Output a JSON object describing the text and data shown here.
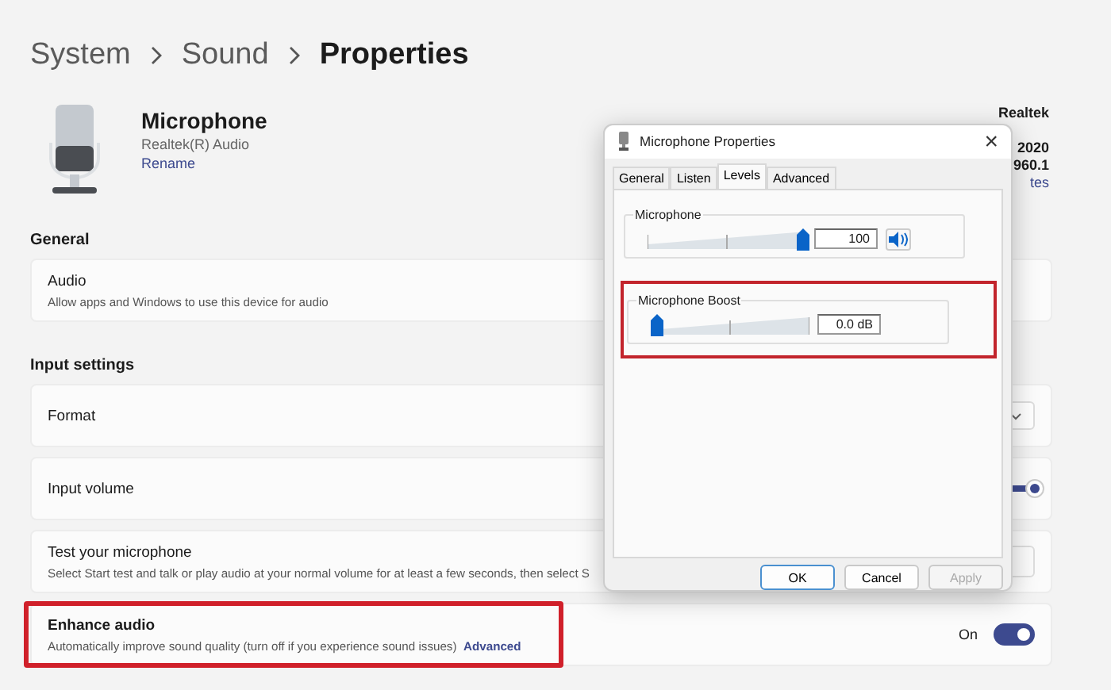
{
  "breadcrumb": [
    "System",
    "Sound",
    "Properties"
  ],
  "device": {
    "name": "Microphone",
    "subtitle": "Realtek(R) Audio",
    "rename": "Rename",
    "info": [
      "Realtek",
      "2020",
      "960.1"
    ],
    "info_link": "tes"
  },
  "sections": [
    {
      "title": "General",
      "rows": [
        {
          "kind": "plain",
          "title": "Audio",
          "description": "Allow apps and Windows to use this device for audio"
        }
      ]
    },
    {
      "title": "Input settings",
      "rows": [
        {
          "kind": "dropdown",
          "title": "Format"
        },
        {
          "kind": "slider",
          "title": "Input volume",
          "level": 1.0
        },
        {
          "kind": "button",
          "title": "Test your microphone",
          "description": "Select Start test and talk or play audio at your normal volume for at least a few seconds, then select S"
        },
        {
          "kind": "toggle",
          "title": "Enhance audio",
          "description": "Automatically improve sound quality (turn off if you experience sound issues)",
          "link": "Advanced",
          "state_label": "On",
          "on": true,
          "highlighted": true
        }
      ]
    }
  ],
  "dialog": {
    "title": "Microphone Properties",
    "close": "×",
    "tabs": [
      {
        "label": "General",
        "selected": false
      },
      {
        "label": "Listen",
        "selected": false
      },
      {
        "label": "Levels",
        "selected": true
      },
      {
        "label": "Advanced",
        "selected": false
      }
    ],
    "groups": [
      {
        "label": "Microphone",
        "level": 1.0,
        "value": "100",
        "mute_button": true,
        "highlighted": false
      },
      {
        "label": "Microphone Boost",
        "level": 0.0,
        "value": "0.0 dB",
        "mute_button": false,
        "highlighted": true
      }
    ],
    "buttons": [
      {
        "label": "OK",
        "kind": "default",
        "disabled": false
      },
      {
        "label": "Cancel",
        "kind": "normal",
        "disabled": false
      },
      {
        "label": "Apply",
        "kind": "normal",
        "disabled": true
      }
    ]
  }
}
